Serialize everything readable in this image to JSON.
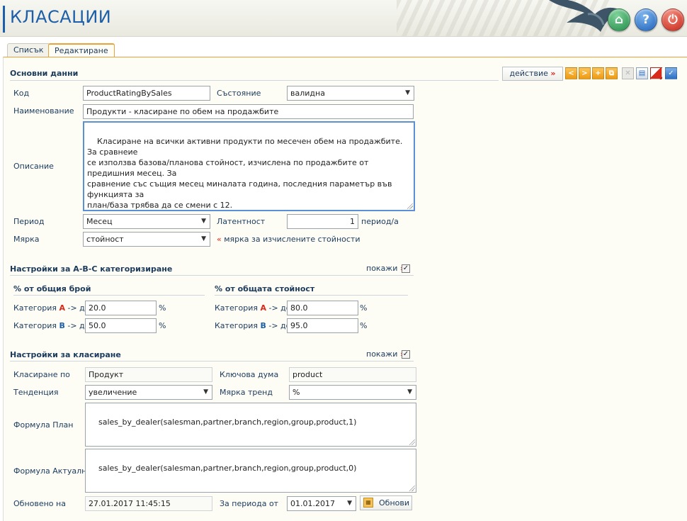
{
  "header": {
    "title": "КЛАСАЦИИ",
    "home_icon": "⌂",
    "help_icon": "?",
    "power_icon": "⏻"
  },
  "tabs": [
    {
      "label": "Списък"
    },
    {
      "label": "Редактиране"
    }
  ],
  "main": {
    "section_title": "Основни данни",
    "action_label": "действие",
    "action_arrow": "»",
    "toolbar_icons": [
      "prev-icon",
      "next-icon",
      "add-icon",
      "copy-icon",
      "delete-icon",
      "print-icon",
      "clear-icon",
      "save-icon"
    ],
    "toolbar_glyphs": {
      "prev": "<",
      "next": ">",
      "add": "+",
      "copy": "⧉",
      "delete": "✕",
      "print": "▤",
      "save": "✓"
    },
    "code": {
      "label": "Код",
      "value": "ProductRatingBySales"
    },
    "status": {
      "label": "Състояние",
      "value": "валидна"
    },
    "name": {
      "label": "Наименование",
      "value": "Продукти - класиране по обем на продажбите"
    },
    "description": {
      "label": "Описание",
      "value": "Класиране на всички активни продукти по месечен обем на продажбите. За сравнеие\nсе използва базова/планова стойност, изчислена по продажбите от предишния месец. За\nсравнение със същия месец миналата година, последния параметър във функцията за\nплан/база трябва да се смени с 12.\nЗа базова стойност може да се постави и константа, като целева стойност. Така може да\nсе види кои продукти се представят над целевата стойност и кои - под нея.\nСравнението в колоната тренд може да бъде разлика (актуално-база) или % (100*\n(актуално-база)/база)."
    },
    "period": {
      "label": "Период",
      "value": "Месец"
    },
    "latency": {
      "label": "Латентност",
      "value": "1",
      "unit": "период/а"
    },
    "measure": {
      "label": "Мярка",
      "value": "стойност",
      "hint_mark": "«",
      "hint": "мярка за изчислените стойности"
    }
  },
  "abc": {
    "section_title": "Настройки за A-B-C категоризиране",
    "show_label": "покажи",
    "show_arrow": "»",
    "show_checked": true,
    "checkmark": "✓",
    "count": {
      "header": "% от общия брой",
      "cat_a": {
        "prefix": "Категория",
        "letter": "A",
        "suffix": "-> до",
        "value": "20.0",
        "unit": "%"
      },
      "cat_b": {
        "prefix": "Категория",
        "letter": "B",
        "suffix": "-> до",
        "value": "50.0",
        "unit": "%"
      }
    },
    "value": {
      "header": "% от общата стойност",
      "cat_a": {
        "prefix": "Категория",
        "letter": "A",
        "suffix": "-> до",
        "value": "80.0",
        "unit": "%"
      },
      "cat_b": {
        "prefix": "Категория",
        "letter": "B",
        "suffix": "-> до",
        "value": "95.0",
        "unit": "%"
      }
    }
  },
  "ranking": {
    "section_title": "Настройки за класиране",
    "show_label": "покажи",
    "show_arrow": "»",
    "show_checked": true,
    "checkmark": "✓",
    "rank_by": {
      "label": "Класиране по",
      "value": "Продукт"
    },
    "keyword": {
      "label": "Ключова дума",
      "value": "product"
    },
    "tendency": {
      "label": "Тенденция",
      "value": "увеличение"
    },
    "trend_measure": {
      "label": "Мярка тренд",
      "value": "%"
    },
    "formula_plan": {
      "label": "Формула План",
      "value": "sales_by_dealer(salesman,partner,branch,region,group,product,1)"
    },
    "formula_actual": {
      "label": "Формула Актуално",
      "value": "sales_by_dealer(salesman,partner,branch,region,group,product,0)"
    },
    "updated": {
      "label": "Обновено на",
      "value": "27.01.2017 11:45:15"
    },
    "period_from": {
      "label": "За периода от",
      "value": "01.01.2017"
    },
    "refresh_label": "Обнови",
    "refresh_icon": "▦"
  },
  "colors": {
    "title_blue": "#1d5fa8",
    "accent_orange": "#e9a13b",
    "label_navy": "#1b3a5c",
    "red_marker": "#d8291b"
  },
  "select_arrow": "▼"
}
